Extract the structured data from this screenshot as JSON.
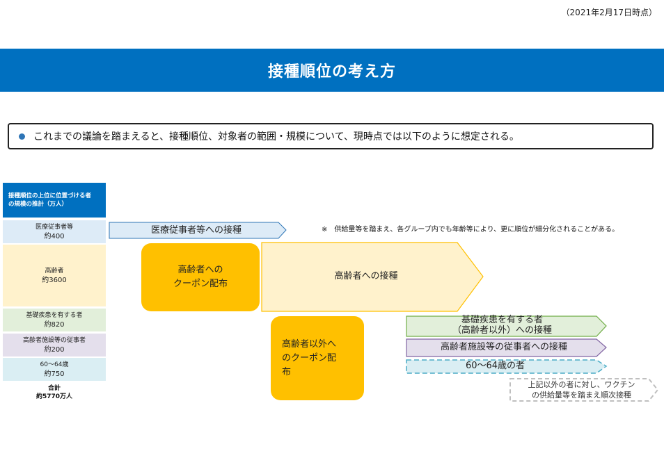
{
  "date_note": "（2021年2月17日時点）",
  "title": "接種順位の考え方",
  "intro": "これまでの議論を踏まえると、接種順位、対象者の範囲・規模について、現時点では以下のように想定される。",
  "table": {
    "header_line1": "接種順位の上位に位置づける者",
    "header_line2": "の規模の推計（万人）",
    "rows": [
      {
        "label": "医療従事者等",
        "value": "約400",
        "color": "#ddebf7"
      },
      {
        "label": "高齢者",
        "value": "約3600",
        "color": "#fff2cc"
      },
      {
        "label": "基礎疾患を有する者",
        "value": "約820",
        "color": "#e2efda"
      },
      {
        "label": "高齢者施設等の従事者",
        "value": "約200",
        "color": "#e4dfec"
      },
      {
        "label": "60～64歳",
        "value": "約750",
        "color": "#daeef3"
      }
    ],
    "total_label": "合計",
    "total_value": "約5770万人"
  },
  "note": "※　供給量等を踏まえ、各グループ内でも年齢等により、更に順位が細分化されることがある。",
  "coupons": {
    "elderly": [
      "高齢者への",
      "クーポン配布"
    ],
    "other": [
      "高齢者以外へ",
      "のクーポン配",
      "布"
    ]
  },
  "arrows": {
    "medical": "医療従事者等への接種",
    "elderly": "高齢者への接種",
    "condition": [
      "基礎疾患を有する者",
      "（高齢者以外）への接種"
    ],
    "facility": "高齢者施設等の従事者への接種",
    "age": "60～64歳の者",
    "others": [
      "上記以外の者に対し、ワクチン",
      "の供給量等を踏まえ順次接種"
    ]
  },
  "colors": {
    "title_bar": "#0070c0",
    "coupon": "#ffc000"
  }
}
